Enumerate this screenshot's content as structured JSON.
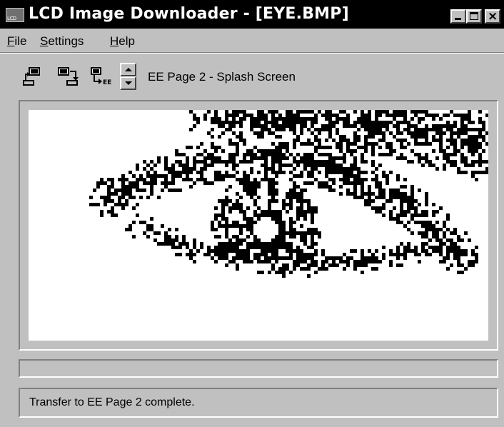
{
  "window": {
    "title": "LCD Image Downloader - [EYE.BMP]",
    "app_icon_text": "LCD"
  },
  "menu": {
    "file": {
      "accel": "F",
      "rest": "ile"
    },
    "settings": {
      "accel": "S",
      "rest": "ettings"
    },
    "help": {
      "accel": "H",
      "rest": "elp"
    }
  },
  "toolbar": {
    "icons": [
      "upload-to-lcd-icon",
      "download-from-lcd-icon",
      "save-to-ee-icon"
    ],
    "ee_badge": "EE",
    "page_label": "EE Page 2 - Splash Screen"
  },
  "image": {
    "name": "EYE.BMP",
    "description_icon": "dithered-eye-bitmap"
  },
  "progress": {
    "value": 0
  },
  "status": {
    "text": "Transfer to EE Page 2 complete."
  },
  "colors": {
    "titlebar": "#000000",
    "face": "#c0c0c0",
    "canvas": "#ffffff",
    "pixel": "#000000"
  }
}
